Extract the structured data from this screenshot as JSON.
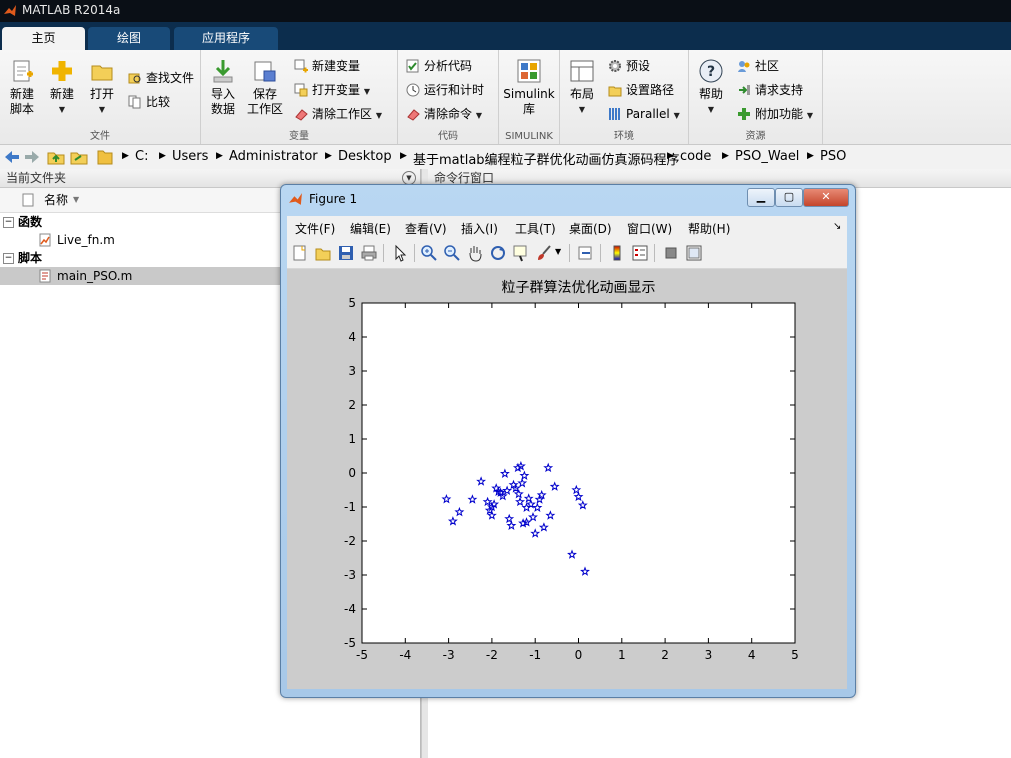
{
  "app": {
    "title": "MATLAB R2014a"
  },
  "tabs": [
    {
      "label": "主页"
    },
    {
      "label": "绘图"
    },
    {
      "label": "应用程序"
    }
  ],
  "ribbon": {
    "file": {
      "label": "文件",
      "new_script": "新建\n脚本",
      "new": "新建",
      "open": "打开",
      "find_files": "查找文件",
      "compare": "比较"
    },
    "variable": {
      "label": "变量",
      "import": "导入\n数据",
      "save_ws": "保存\n工作区",
      "new_var": "新建变量",
      "open_var": "打开变量",
      "clear_ws": "清除工作区"
    },
    "code": {
      "label": "代码",
      "analyze": "分析代码",
      "run_time": "运行和计时",
      "clear_cmd": "清除命令"
    },
    "simulink": {
      "label": "SIMULINK",
      "lib": "Simulink\n库"
    },
    "env": {
      "label": "环境",
      "layout": "布局",
      "prefs": "预设",
      "set_path": "设置路径",
      "parallel": "Parallel"
    },
    "resources": {
      "label": "资源",
      "help": "帮助",
      "community": "社区",
      "support": "请求支持",
      "addons": "附加功能"
    }
  },
  "address": {
    "crumbs": [
      "C:",
      "Users",
      "Administrator",
      "Desktop",
      "基于matlab编程粒子群优化动画仿真源码程序",
      "code",
      "PSO_Wael",
      "PSO"
    ]
  },
  "left_panel": {
    "title": "当前文件夹",
    "col_name": "名称",
    "groups": [
      {
        "label": "函数",
        "files": [
          "Live_fn.m"
        ]
      },
      {
        "label": "脚本",
        "files": [
          "main_PSO.m"
        ]
      }
    ]
  },
  "command_window": {
    "title": "命令行窗口"
  },
  "figure": {
    "title": "Figure 1",
    "menu": [
      "文件(F)",
      "编辑(E)",
      "查看(V)",
      "插入(I)",
      "工具(T)",
      "桌面(D)",
      "窗口(W)",
      "帮助(H)"
    ],
    "colors": {
      "marker": "#0000cc",
      "plot_bg": "#ffffff",
      "figure_bg": "#cccccc"
    }
  },
  "chart_data": {
    "type": "scatter",
    "title": "粒子群算法优化动画显示",
    "xlabel": "",
    "ylabel": "",
    "xlim": [
      -5,
      5
    ],
    "ylim": [
      -5,
      5
    ],
    "xticks": [
      -5,
      -4,
      -3,
      -2,
      -1,
      0,
      1,
      2,
      3,
      4,
      5
    ],
    "yticks": [
      -5,
      -4,
      -3,
      -2,
      -1,
      0,
      1,
      2,
      3,
      4,
      5
    ],
    "marker": "pentagram",
    "grid": false,
    "points": [
      [
        -3.05,
        -0.77
      ],
      [
        -2.9,
        -1.42
      ],
      [
        -2.75,
        -1.15
      ],
      [
        -2.45,
        -0.78
      ],
      [
        -2.25,
        -0.25
      ],
      [
        -2.1,
        -0.85
      ],
      [
        -2.05,
        -1.1
      ],
      [
        -2.0,
        -1.25
      ],
      [
        -1.95,
        -0.92
      ],
      [
        -1.9,
        -0.45
      ],
      [
        -1.8,
        -0.58
      ],
      [
        -1.75,
        -0.68
      ],
      [
        -1.7,
        -0.02
      ],
      [
        -1.65,
        -0.52
      ],
      [
        -1.6,
        -1.35
      ],
      [
        -1.55,
        -1.55
      ],
      [
        -1.5,
        -0.35
      ],
      [
        -1.45,
        -0.45
      ],
      [
        -1.4,
        0.15
      ],
      [
        -1.38,
        -0.62
      ],
      [
        -1.35,
        -0.85
      ],
      [
        -1.33,
        0.2
      ],
      [
        -1.3,
        -0.3
      ],
      [
        -1.28,
        -1.48
      ],
      [
        -1.25,
        -0.08
      ],
      [
        -1.2,
        -1.02
      ],
      [
        -1.15,
        -0.75
      ],
      [
        -1.1,
        -0.92
      ],
      [
        -1.05,
        -1.3
      ],
      [
        -1.0,
        -1.78
      ],
      [
        -0.95,
        -1.02
      ],
      [
        -0.9,
        -0.78
      ],
      [
        -0.85,
        -0.65
      ],
      [
        -0.8,
        -1.6
      ],
      [
        -0.7,
        0.15
      ],
      [
        -0.65,
        -1.25
      ],
      [
        -0.55,
        -0.4
      ],
      [
        -0.15,
        -2.4
      ],
      [
        -0.05,
        -0.5
      ],
      [
        0.0,
        -0.7
      ],
      [
        0.1,
        -0.95
      ],
      [
        0.15,
        -2.9
      ],
      [
        -2.0,
        -1.0
      ],
      [
        -1.85,
        -0.55
      ],
      [
        -1.2,
        -1.45
      ]
    ]
  }
}
